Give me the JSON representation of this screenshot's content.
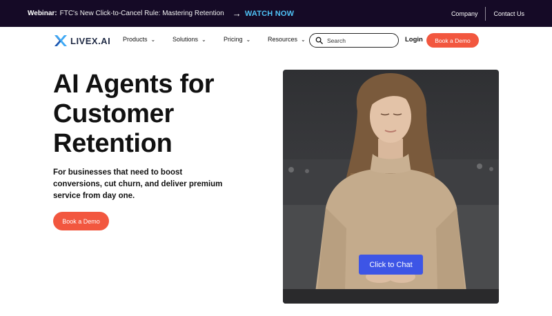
{
  "announcement": {
    "lead": "Webinar:",
    "message": "FTC's New Click-to-Cancel Rule: Mastering Retention",
    "cta": "WATCH NOW"
  },
  "top_links": [
    "Company",
    "Contact Us"
  ],
  "brand": {
    "name": "LIVEX.AI",
    "accent": "#3fa9f5"
  },
  "nav": {
    "items": [
      {
        "label": "Products"
      },
      {
        "label": "Solutions"
      },
      {
        "label": "Pricing"
      },
      {
        "label": "Resources"
      }
    ],
    "search_placeholder": "Search",
    "login": "Login",
    "demo_button": "Book a Demo"
  },
  "hero": {
    "title_lines": [
      "AI Agents for",
      "Customer",
      "Retention"
    ],
    "subtitle": "For businesses that need to boost conversions, cut churn, and deliver premium service from day one.",
    "cta": "Book a Demo"
  },
  "video": {
    "chat_button": "Click to Chat"
  },
  "colors": {
    "topbar_bg": "#150a26",
    "cta_orange": "#f2573f",
    "chat_blue": "#3d55e6",
    "watch_link": "#4fc3f7"
  }
}
